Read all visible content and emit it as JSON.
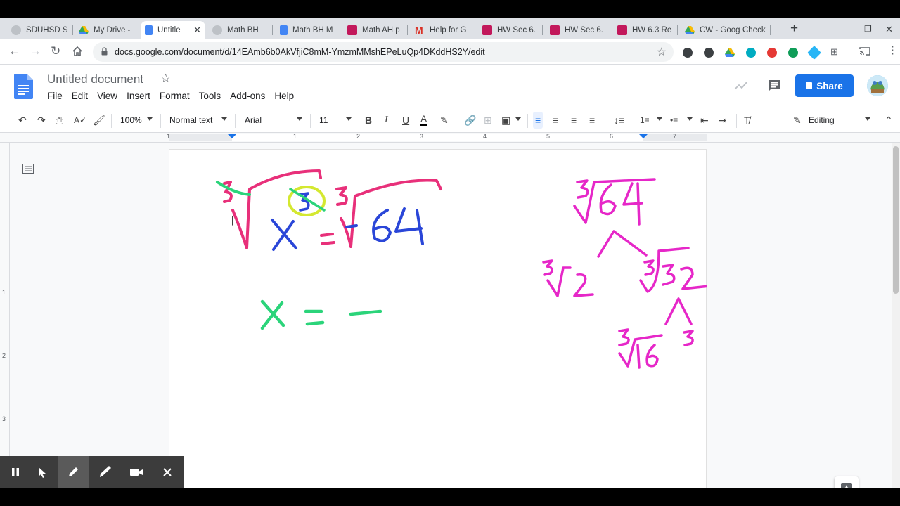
{
  "tabs": [
    {
      "label": "SDUHSD S",
      "icon": "sduhsd-favicon",
      "color": "#9aa0a6"
    },
    {
      "label": "My Drive -",
      "icon": "drive-favicon",
      "color": "#34a853"
    },
    {
      "label": "Untitle",
      "icon": "docs-favicon",
      "color": "#4285f4",
      "active": true
    },
    {
      "label": "Math BH",
      "icon": "sduhsd-favicon",
      "color": "#9aa0a6"
    },
    {
      "label": "Math BH M",
      "icon": "docs-favicon",
      "color": "#4285f4"
    },
    {
      "label": "Math AH p",
      "icon": "classroom-favicon",
      "color": "#c2185b"
    },
    {
      "label": "Help for G",
      "icon": "gmail-favicon",
      "color": "#d93025"
    },
    {
      "label": "HW Sec 6.",
      "icon": "classroom-favicon",
      "color": "#c2185b"
    },
    {
      "label": "HW Sec 6.",
      "icon": "classroom-favicon",
      "color": "#c2185b"
    },
    {
      "label": "HW 6.3 Re",
      "icon": "classroom-favicon",
      "color": "#c2185b"
    },
    {
      "label": "CW - Goog",
      "icon": "drive-favicon",
      "color": "#34a853"
    },
    {
      "label": "Check",
      "icon": "none",
      "color": "#dee1e6"
    }
  ],
  "browser": {
    "url": "docs.google.com/document/d/14EAmb6b0AkVfjiC8mM-YmzmMMshEPeLuQp4DKddHS2Y/edit",
    "new_tab": "+",
    "minimize": "–",
    "restore": "❐",
    "close": "✕"
  },
  "doc": {
    "title": "Untitled document",
    "menu": [
      "File",
      "Edit",
      "View",
      "Insert",
      "Format",
      "Tools",
      "Add-ons",
      "Help"
    ],
    "share_label": "Share",
    "share_color": "#1a73e8"
  },
  "toolbar": {
    "zoom": "100%",
    "style": "Normal text",
    "font": "Arial",
    "size": "11",
    "mode": "Editing"
  },
  "ruler": {
    "labels": [
      "1",
      "1",
      "2",
      "3",
      "4",
      "5",
      "6",
      "7"
    ],
    "vlabels": [
      "1",
      "2",
      "3"
    ]
  },
  "handwriting": {
    "colors": {
      "pink": "#e8307a",
      "blue": "#2a46d8",
      "green": "#2bd47a",
      "yellow": "#d4e830",
      "magenta": "#e627c8"
    }
  },
  "screencast": {
    "tools": [
      "pause-icon",
      "pointer-icon",
      "pen-icon",
      "highlighter-icon",
      "camera-icon",
      "close-icon"
    ]
  }
}
